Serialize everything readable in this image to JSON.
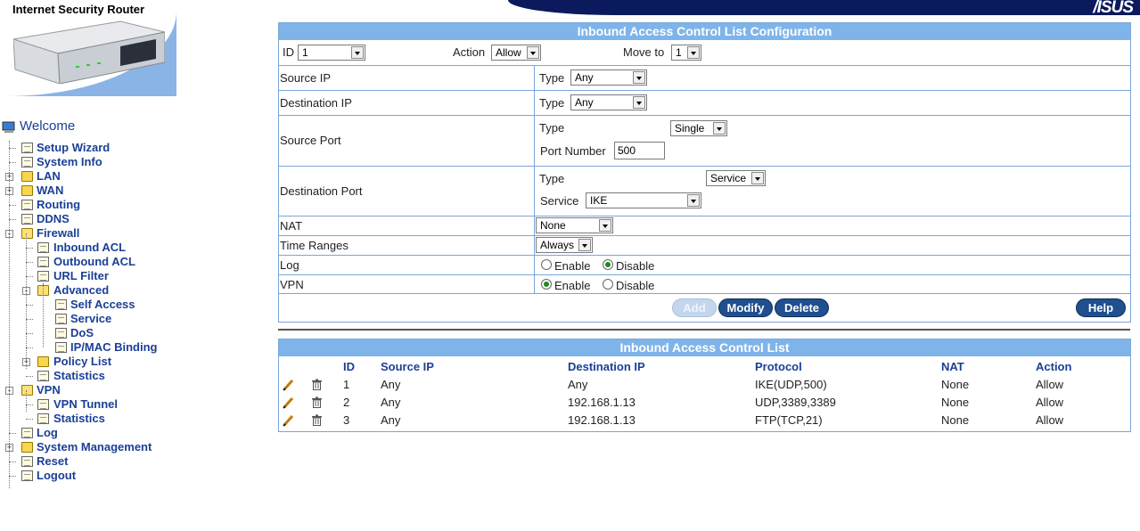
{
  "header": {
    "product_title": "Internet Security Router",
    "brand": "/ISUS"
  },
  "tree": [
    {
      "label": "Welcome",
      "level": 0,
      "icon": "computer-icon"
    },
    {
      "label": "Setup Wizard",
      "level": 1,
      "icon": "document-icon"
    },
    {
      "label": "System Info",
      "level": 1,
      "icon": "document-icon"
    },
    {
      "label": "LAN",
      "level": 1,
      "icon": "folder-icon",
      "toggle": "+"
    },
    {
      "label": "WAN",
      "level": 1,
      "icon": "folder-icon",
      "toggle": "+"
    },
    {
      "label": "Routing",
      "level": 1,
      "icon": "document-icon"
    },
    {
      "label": "DDNS",
      "level": 1,
      "icon": "document-icon"
    },
    {
      "label": "Firewall",
      "level": 1,
      "icon": "open-folder-icon",
      "toggle": "-"
    },
    {
      "label": "Inbound ACL",
      "level": 2,
      "icon": "document-icon"
    },
    {
      "label": "Outbound ACL",
      "level": 2,
      "icon": "document-icon"
    },
    {
      "label": "URL Filter",
      "level": 2,
      "icon": "document-icon"
    },
    {
      "label": "Advanced",
      "level": 2,
      "icon": "open-folder-icon",
      "toggle": "-"
    },
    {
      "label": "Self Access",
      "level": 3,
      "icon": "document-icon"
    },
    {
      "label": "Service",
      "level": 3,
      "icon": "document-icon"
    },
    {
      "label": "DoS",
      "level": 3,
      "icon": "document-icon"
    },
    {
      "label": "IP/MAC Binding",
      "level": 3,
      "icon": "document-icon"
    },
    {
      "label": "Policy List",
      "level": 2,
      "icon": "folder-icon",
      "toggle": "+"
    },
    {
      "label": "Statistics",
      "level": 2,
      "icon": "document-icon"
    },
    {
      "label": "VPN",
      "level": 1,
      "icon": "open-folder-icon",
      "toggle": "-"
    },
    {
      "label": "VPN Tunnel",
      "level": 2,
      "icon": "document-icon"
    },
    {
      "label": "Statistics",
      "level": 2,
      "icon": "document-icon"
    },
    {
      "label": "Log",
      "level": 1,
      "icon": "document-icon"
    },
    {
      "label": "System Management",
      "level": 1,
      "icon": "folder-icon",
      "toggle": "+"
    },
    {
      "label": "Reset",
      "level": 1,
      "icon": "document-icon"
    },
    {
      "label": "Logout",
      "level": 1,
      "icon": "document-icon"
    }
  ],
  "config": {
    "title": "Inbound Access Control List Configuration",
    "id_label": "ID",
    "id_value": "1",
    "action_label": "Action",
    "action_value": "Allow",
    "move_label": "Move to",
    "move_value": "1",
    "source_ip": {
      "label": "Source IP",
      "type_label": "Type",
      "type_value": "Any"
    },
    "dest_ip": {
      "label": "Destination IP",
      "type_label": "Type",
      "type_value": "Any"
    },
    "source_port": {
      "label": "Source Port",
      "type_label": "Type",
      "type_value": "Single",
      "port_label": "Port Number",
      "port_value": "500"
    },
    "dest_port": {
      "label": "Destination Port",
      "type_label": "Type",
      "type_value": "Service",
      "service_label": "Service",
      "service_value": "IKE"
    },
    "nat": {
      "label": "NAT",
      "value": "None"
    },
    "time": {
      "label": "Time Ranges",
      "value": "Always"
    },
    "log": {
      "label": "Log",
      "enable": "Enable",
      "disable": "Disable",
      "selected": "Disable"
    },
    "vpn": {
      "label": "VPN",
      "enable": "Enable",
      "disable": "Disable",
      "selected": "Enable"
    },
    "buttons": {
      "add": "Add",
      "modify": "Modify",
      "delete": "Delete",
      "help": "Help"
    }
  },
  "list": {
    "title": "Inbound Access Control List",
    "columns": [
      "ID",
      "Source IP",
      "Destination IP",
      "Protocol",
      "NAT",
      "Action"
    ],
    "rows": [
      {
        "id": "1",
        "source": "Any",
        "dest": "Any",
        "protocol": "IKE(UDP,500)",
        "nat": "None",
        "action": "Allow"
      },
      {
        "id": "2",
        "source": "Any",
        "dest": "192.168.1.13",
        "protocol": "UDP,3389,3389",
        "nat": "None",
        "action": "Allow"
      },
      {
        "id": "3",
        "source": "Any",
        "dest": "192.168.1.13",
        "protocol": "FTP(TCP,21)",
        "nat": "None",
        "action": "Allow"
      }
    ]
  }
}
